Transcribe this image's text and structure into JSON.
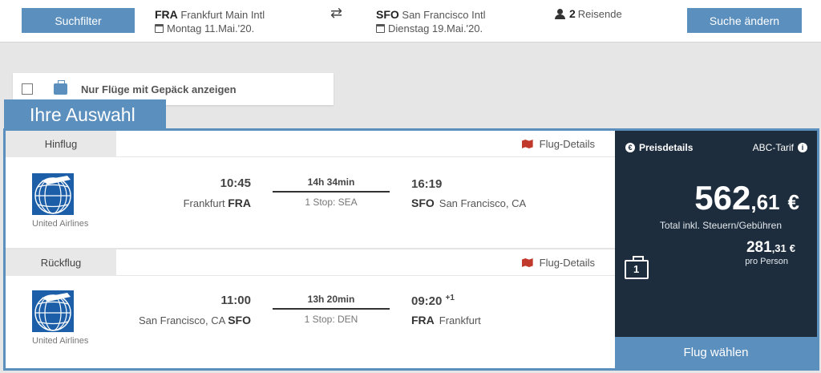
{
  "header": {
    "filter_button": "Suchfilter",
    "origin": {
      "code": "FRA",
      "name": "Frankfurt Main Intl",
      "date": "Montag 11.Mai.'20."
    },
    "destination": {
      "code": "SFO",
      "name": "San Francisco Intl",
      "date": "Dienstag 19.Mai.'20."
    },
    "travellers": {
      "count": "2",
      "label": "Reisende"
    },
    "change_button": "Suche ändern"
  },
  "baggage_filter": {
    "label": "Nur Flüge mit Gepäck anzeigen",
    "checked": false
  },
  "selection_title": "Ihre Auswahl",
  "outbound": {
    "tab": "Hinflug",
    "details": "Flug-Details",
    "airline": "United Airlines",
    "dep_time": "10:45",
    "dep_city": "Frankfurt",
    "dep_code": "FRA",
    "duration": "14h 34min",
    "stops": "1 Stop: SEA",
    "arr_time": "16:19",
    "arr_day_offset": "",
    "arr_code": "SFO",
    "arr_city": "San Francisco, CA"
  },
  "return": {
    "tab": "Rückflug",
    "details": "Flug-Details",
    "airline": "United Airlines",
    "dep_time": "11:00",
    "dep_city": "San Francisco, CA",
    "dep_code": "SFO",
    "duration": "13h 20min",
    "stops": "1 Stop: DEN",
    "arr_time": "09:20",
    "arr_day_offset": "+1",
    "arr_code": "FRA",
    "arr_city": "Frankfurt"
  },
  "price": {
    "details_label": "Preisdetails",
    "tarif": "ABC-Tarif",
    "total_int": "562",
    "total_dec": ",61",
    "currency": "€",
    "total_label": "Total inkl. Steuern/Gebühren",
    "pp_int": "281",
    "pp_dec": ",31",
    "pp_label": "pro Person",
    "baggage_count": "1",
    "select_button": "Flug wählen"
  },
  "colors": {
    "accent": "#5b8fbe",
    "panel": "#1d2d3d",
    "map_icon": "#c0392b"
  }
}
